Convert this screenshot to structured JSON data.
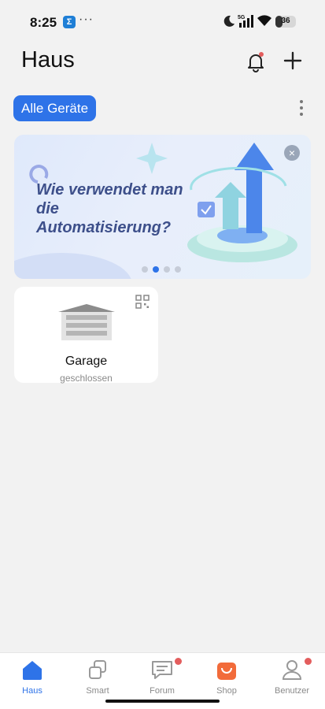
{
  "status_bar": {
    "time": "8:25",
    "app_badge": "Σ",
    "overflow": "···",
    "network": "5G",
    "battery": "36"
  },
  "header": {
    "title": "Haus"
  },
  "filter": {
    "label": "Alle Geräte"
  },
  "banner": {
    "text": "Wie verwendet man die Automatisierung?",
    "pages": 4,
    "active_page": 2
  },
  "devices": [
    {
      "name": "Garage",
      "status": "geschlossen"
    }
  ],
  "nav": {
    "items": [
      {
        "label": "Haus",
        "active": true
      },
      {
        "label": "Smart"
      },
      {
        "label": "Forum",
        "badge": true
      },
      {
        "label": "Shop"
      },
      {
        "label": "Benutzer",
        "badge": true
      }
    ]
  },
  "colors": {
    "accent": "#2e73e8",
    "background": "#f2f2f2",
    "badge": "#e35d5d",
    "shop": "#f26b3a"
  }
}
